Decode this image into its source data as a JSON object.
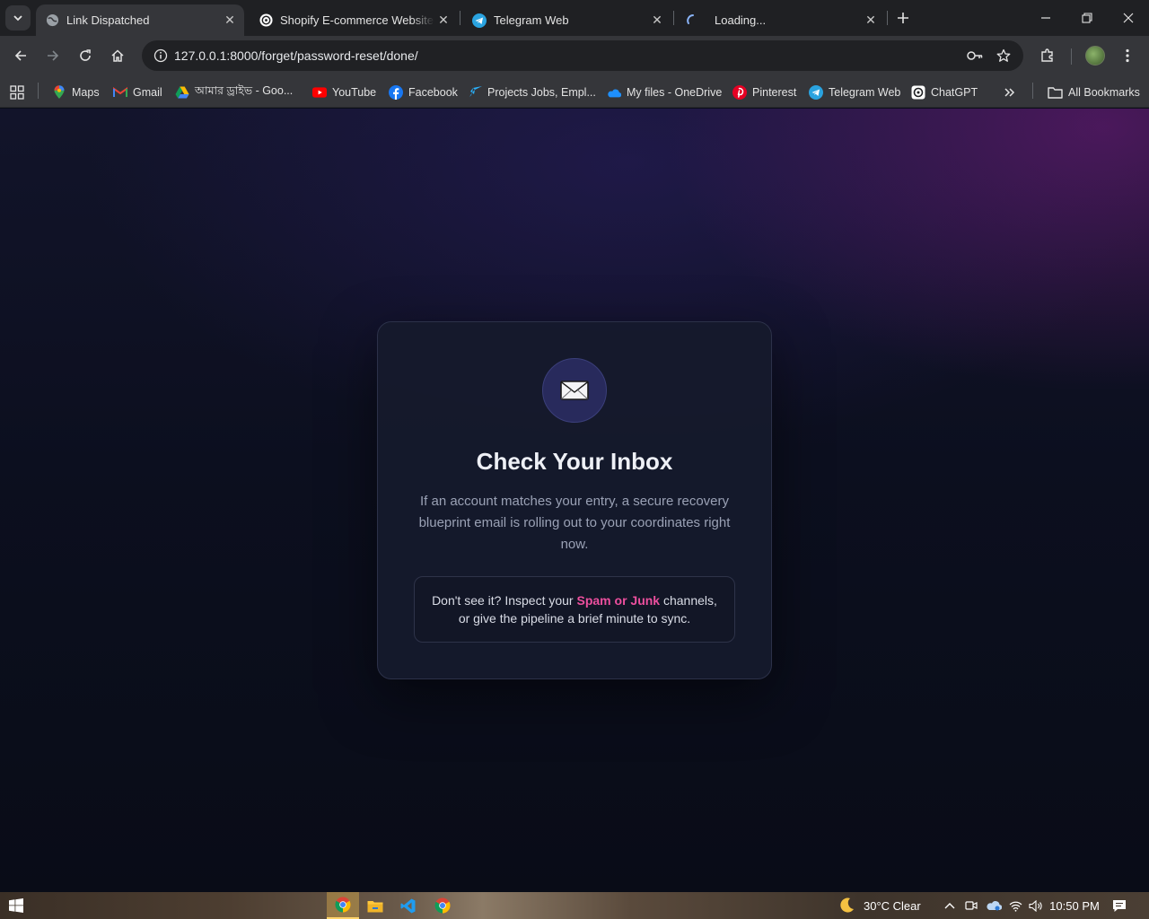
{
  "browser": {
    "tabs": [
      {
        "title": "Link Dispatched",
        "active": true,
        "icon": "globe-icon"
      },
      {
        "title": "Shopify E-commerce Website B",
        "active": false,
        "icon": "chatgpt-icon"
      },
      {
        "title": "Telegram Web",
        "active": false,
        "icon": "telegram-icon"
      },
      {
        "title": "Loading...",
        "active": false,
        "icon": "loading-spinner-icon"
      }
    ],
    "url": "127.0.0.1:8000/forget/password-reset/done/",
    "bookmarks": [
      {
        "label": "Maps",
        "icon": "maps-icon"
      },
      {
        "label": "Gmail",
        "icon": "gmail-icon"
      },
      {
        "label": "আমার ড্রাইভ - Goo...",
        "icon": "google-drive-icon"
      },
      {
        "label": "YouTube",
        "icon": "youtube-icon"
      },
      {
        "label": "Facebook",
        "icon": "facebook-icon"
      },
      {
        "label": "Projects Jobs, Empl...",
        "icon": "freelancer-icon"
      },
      {
        "label": "My files - OneDrive",
        "icon": "onedrive-icon"
      },
      {
        "label": "Pinterest",
        "icon": "pinterest-icon"
      },
      {
        "label": "Telegram Web",
        "icon": "telegram-icon"
      },
      {
        "label": "ChatGPT",
        "icon": "chatgpt-icon"
      }
    ],
    "all_bookmarks": "All Bookmarks"
  },
  "card": {
    "icon": "envelope-icon",
    "title": "Check Your Inbox",
    "text": "If an account matches your entry, a secure recovery blueprint email is rolling out to your coordinates right now.",
    "hint_before": "Don't see it? Inspect your ",
    "hint_highlight": "Spam or Junk",
    "hint_after": " channels, or give the pipeline a brief minute to sync."
  },
  "taskbar": {
    "weather": "30°C  Clear",
    "time": "10:50 PM"
  },
  "colors": {
    "accent_pink": "#ec4f9e",
    "icon_circle": "#282a5c",
    "card_bg": "#161a2c"
  }
}
